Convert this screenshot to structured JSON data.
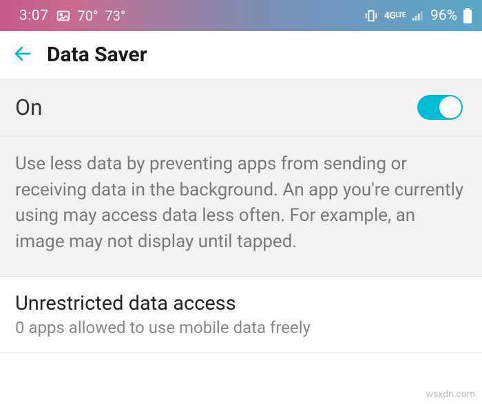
{
  "statusbar": {
    "time": "3:07",
    "temp1": "70°",
    "temp2": "73°",
    "network_label": "4G",
    "battery_percent": "96%"
  },
  "header": {
    "title": "Data Saver"
  },
  "toggle": {
    "label": "On",
    "state": "on"
  },
  "description": "Use less data by preventing apps from sending or receiving data in the background. An app you're currently using may access data less often. For example, an image may not display until tapped.",
  "unrestricted": {
    "title": "Unrestricted data access",
    "subtitle": "0 apps allowed to use mobile data freely"
  },
  "watermark": "wsxdn.com",
  "colors": {
    "accent": "#00bcd4"
  }
}
